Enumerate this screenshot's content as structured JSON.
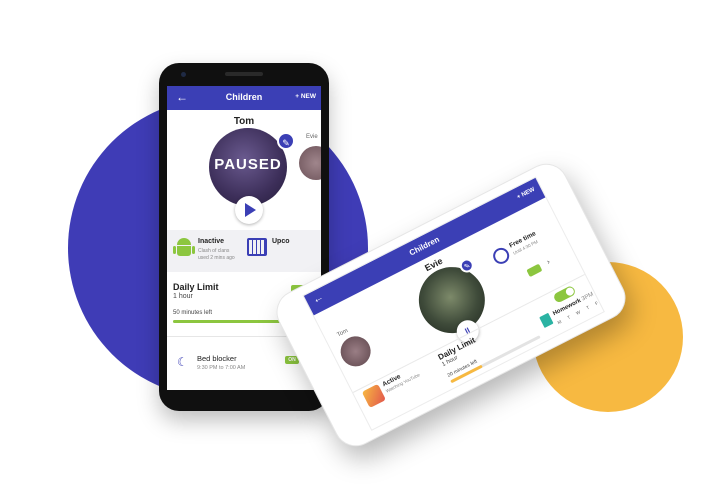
{
  "colors": {
    "primary": "#3b3fb5",
    "accent_green": "#8cc63f",
    "accent_yellow": "#f7b941",
    "blob_blue": "#3f3cb6"
  },
  "phone_main": {
    "header": {
      "back_icon": "arrow-left-icon",
      "title": "Children",
      "new_label": "+ NEW"
    },
    "child_name": "Tom",
    "avatar_overlay": "PAUSED",
    "side_child": "Evie",
    "status": {
      "title": "Inactive",
      "subtitle": "Clash of clans used 2 mins ago"
    },
    "schedule": {
      "title": "Upco"
    },
    "daily_limit": {
      "title": "Daily Limit",
      "value": "1 hour",
      "remaining": "50 minutes left",
      "progress": 0.95
    },
    "bed_blocker": {
      "title": "Bed blocker",
      "time": "9:30 PM to 7:00 AM",
      "badge": "ON"
    }
  },
  "phone_tilted": {
    "header": {
      "title": "Children",
      "new_label": "+ NEW"
    },
    "child_name": "Evie",
    "side_child": "Tom",
    "free_time": {
      "title": "Free time",
      "subtitle": "Until 4:30 PM"
    },
    "active": {
      "title": "Active",
      "subtitle": "Watching YouTube"
    },
    "daily_limit": {
      "title": "Daily Limit",
      "value": "1 hour",
      "remaining": "20 minutes left",
      "progress": 0.35
    },
    "homework": {
      "title": "Homework",
      "time": "3PM to 5:30 PM",
      "days": "M T W T F S S"
    }
  }
}
